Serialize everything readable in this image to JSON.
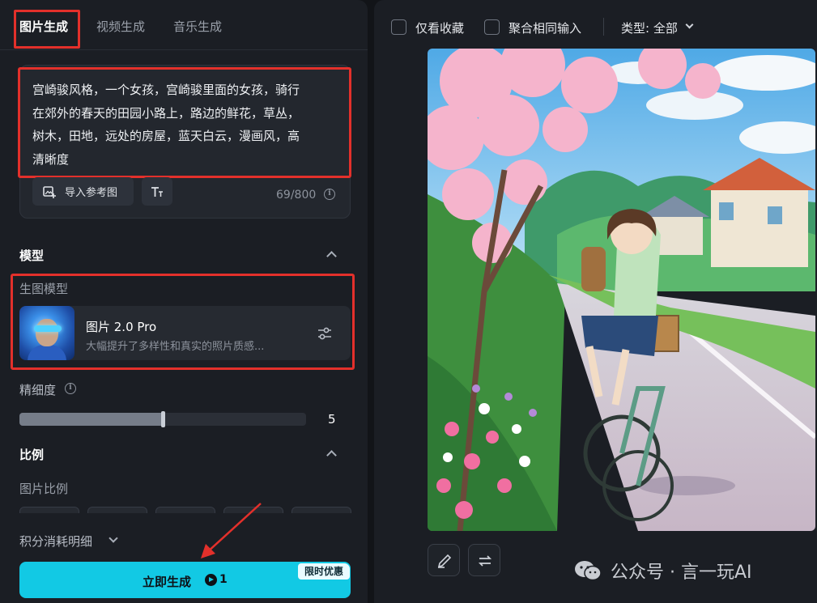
{
  "tabs": [
    {
      "label": "图片生成",
      "active": true
    },
    {
      "label": "视频生成",
      "active": false
    },
    {
      "label": "音乐生成",
      "active": false
    }
  ],
  "prompt": {
    "lines": [
      "宫崎骏风格，一个女孩，宫崎骏里面的女孩，骑行",
      "在郊外的春天的田园小路上，路边的鲜花，草丛，",
      "树木，田地，远处的房屋，蓝天白云，漫画风，高",
      "清晰度"
    ],
    "import_ref_label": "导入参考图",
    "char_count": "69/800"
  },
  "model_section": {
    "title": "模型",
    "sub_label": "生图模型",
    "model_name": "图片 2.0 Pro",
    "model_desc": "大幅提升了多样性和真实的照片质感..."
  },
  "detail": {
    "label": "精细度",
    "value": "5",
    "level_fraction": 0.5
  },
  "ratio_section": {
    "title": "比例",
    "sub_label": "图片比例"
  },
  "credits_label": "积分消耗明细",
  "generate": {
    "label": "立即生成",
    "cost": "1",
    "promo": "限时优惠"
  },
  "toolbar": {
    "favorites_label": "仅看收藏",
    "merge_label": "聚合相同输入",
    "type_label": "类型: 全部"
  },
  "watermark": "公众号 · 言一玩AI",
  "icons": [
    "image-import-icon",
    "text-format-icon",
    "info-icon",
    "chevron-up-icon",
    "sliders-icon",
    "chevron-down-icon",
    "play-coin-icon",
    "pencil-icon",
    "swap-icon",
    "wechat-icon"
  ],
  "colors": {
    "accent": "#12c9e4",
    "annotation": "#e3302b",
    "panel": "#1b1e24"
  }
}
